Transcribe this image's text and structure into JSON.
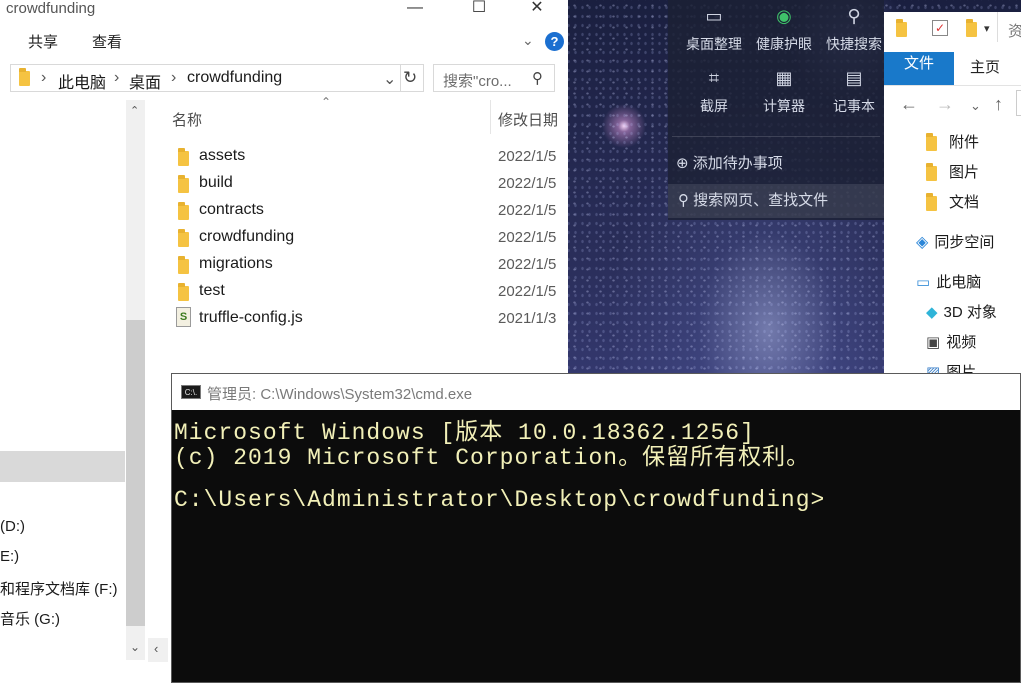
{
  "explorer_left": {
    "window_title": "crowdfunding",
    "ribbon_tabs": [
      "共享",
      "查看"
    ],
    "help_label": "?",
    "breadcrumb": [
      "此电脑",
      "桌面",
      "crowdfunding"
    ],
    "search_placeholder": "搜索\"cro...",
    "columns": {
      "name": "名称",
      "date": "修改日期"
    },
    "files": [
      {
        "name": "assets",
        "date": "2022/1/5",
        "type": "folder"
      },
      {
        "name": "build",
        "date": "2022/1/5",
        "type": "folder"
      },
      {
        "name": "contracts",
        "date": "2022/1/5",
        "type": "folder"
      },
      {
        "name": "crowdfunding",
        "date": "2022/1/5",
        "type": "folder"
      },
      {
        "name": "migrations",
        "date": "2022/1/5",
        "type": "folder"
      },
      {
        "name": "test",
        "date": "2022/1/5",
        "type": "folder"
      },
      {
        "name": "truffle-config.js",
        "date": "2021/1/3",
        "type": "js"
      }
    ],
    "drives": [
      " (D:)",
      "E:)",
      "和程序文档库 (F:)",
      "音乐 (G:)"
    ]
  },
  "quick_panel": {
    "row1": [
      "桌面整理",
      "健康护眼",
      "快捷搜索"
    ],
    "row2": [
      "截屏",
      "计算器",
      "记事本"
    ],
    "add_todo": "添加待办事项",
    "search": "搜索网页、查找文件"
  },
  "explorer_right": {
    "tabs": [
      "文件",
      "主页"
    ],
    "title_fragment": "资",
    "nav_items": [
      "附件",
      "图片",
      "文档",
      "同步空间",
      "此电脑",
      "3D 对象",
      "视频",
      "图片"
    ]
  },
  "cmd": {
    "title": "管理员: C:\\Windows\\System32\\cmd.exe",
    "icon_text": "C:\\.",
    "lines": [
      "Microsoft Windows [版本 10.0.18362.1256]",
      "(c) 2019 Microsoft Corporation。保留所有权利。",
      "",
      "C:\\Users\\Administrator\\Desktop\\crowdfunding>"
    ]
  },
  "colors": {
    "ribbon_active": "#1979ca",
    "cmd_bg": "#0c0c0c",
    "cmd_text": "#f2f0b8",
    "folder": "#f5c342"
  }
}
